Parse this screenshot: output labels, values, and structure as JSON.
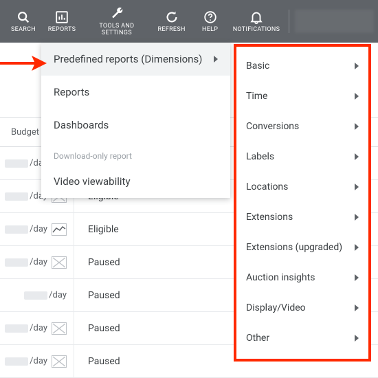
{
  "toolbar": {
    "items": [
      {
        "key": "search",
        "label": "SEARCH"
      },
      {
        "key": "reports",
        "label": "REPORTS"
      },
      {
        "key": "tools",
        "label": "TOOLS AND SETTINGS"
      },
      {
        "key": "refresh",
        "label": "REFRESH"
      },
      {
        "key": "help",
        "label": "HELP"
      },
      {
        "key": "notifications",
        "label": "NOTIFICATIONS"
      }
    ]
  },
  "table": {
    "budget_header": "Budget",
    "rows": [
      {
        "budget_suffix": "/day",
        "status": "",
        "spark": "diag"
      },
      {
        "budget_suffix": "/day",
        "status": "Eligible",
        "spark": "diag"
      },
      {
        "budget_suffix": "/day",
        "status": "Eligible",
        "spark": "line"
      },
      {
        "budget_suffix": "/day",
        "status": "Paused",
        "spark": "diag"
      },
      {
        "budget_suffix": "/day",
        "status": "Paused",
        "spark": "none"
      },
      {
        "budget_suffix": "/day",
        "status": "Paused",
        "spark": "diag"
      },
      {
        "budget_suffix": "/day",
        "status": "Paused",
        "spark": "diag"
      }
    ]
  },
  "reports_menu": {
    "items": [
      {
        "key": "predefined",
        "label": "Predefined reports (Dimensions)",
        "has_sub": true
      },
      {
        "key": "reports",
        "label": "Reports",
        "has_sub": false
      },
      {
        "key": "dashboards",
        "label": "Dashboards",
        "has_sub": false
      }
    ],
    "section_label": "Download-only report",
    "download_items": [
      {
        "key": "video",
        "label": "Video viewability"
      }
    ]
  },
  "predefined_submenu": {
    "items": [
      {
        "key": "basic",
        "label": "Basic"
      },
      {
        "key": "time",
        "label": "Time"
      },
      {
        "key": "conversions",
        "label": "Conversions"
      },
      {
        "key": "labels",
        "label": "Labels"
      },
      {
        "key": "locations",
        "label": "Locations"
      },
      {
        "key": "extensions",
        "label": "Extensions"
      },
      {
        "key": "extensions-upgraded",
        "label": "Extensions (upgraded)"
      },
      {
        "key": "auction",
        "label": "Auction insights"
      },
      {
        "key": "display-video",
        "label": "Display/Video"
      },
      {
        "key": "other",
        "label": "Other"
      }
    ]
  }
}
